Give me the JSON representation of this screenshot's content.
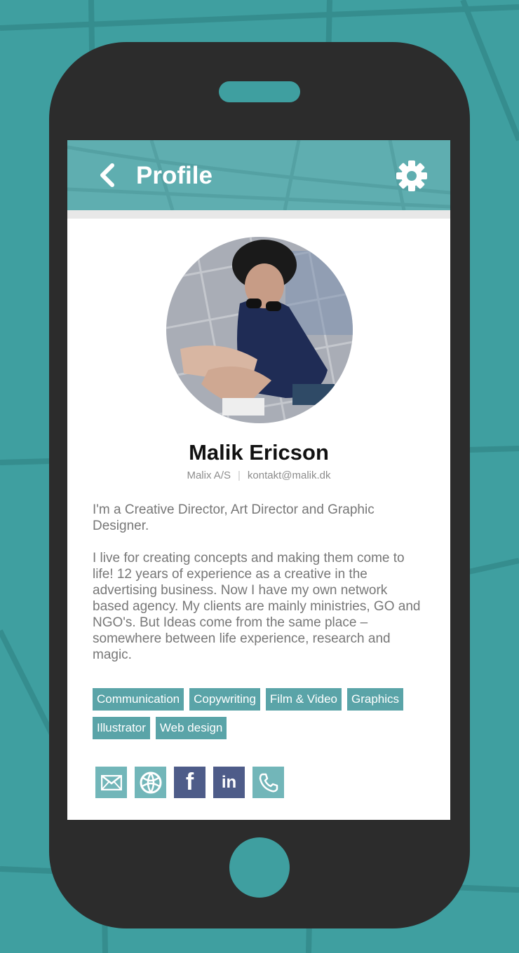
{
  "header": {
    "title": "Profile"
  },
  "profile": {
    "name": "Malik Ericson",
    "company": "Malix A/S",
    "separator": "|",
    "email": "kontakt@malik.dk",
    "bio": [
      "I'm a Creative Director, Art Director and Graphic Designer.",
      "I live for creating concepts and making them come to life! 12 years of experience as a creative in the advertising business. Now I have my own network based agency. My clients are mainly ministries, GO and NGO's. But Ideas come from the same place – somewhere between life experience, research and magic."
    ]
  },
  "tags": [
    "Communication",
    "Copywriting",
    "Film & Video",
    "Graphics",
    "Illustrator",
    "Web design"
  ],
  "socials": [
    {
      "icon": "mail-icon",
      "color": "#72b6b9"
    },
    {
      "icon": "globe-icon",
      "color": "#72b6b9"
    },
    {
      "icon": "facebook-icon",
      "glyph": "f",
      "color": "#4e5c89"
    },
    {
      "icon": "linkedin-icon",
      "glyph": "in",
      "color": "#4e5c89"
    },
    {
      "icon": "phone-icon",
      "color": "#72b6b9"
    }
  ],
  "colors": {
    "background": "#3f9fa0",
    "phone": "#2c2c2c",
    "header": "#5faeb0",
    "tag": "#5aa4a8"
  }
}
